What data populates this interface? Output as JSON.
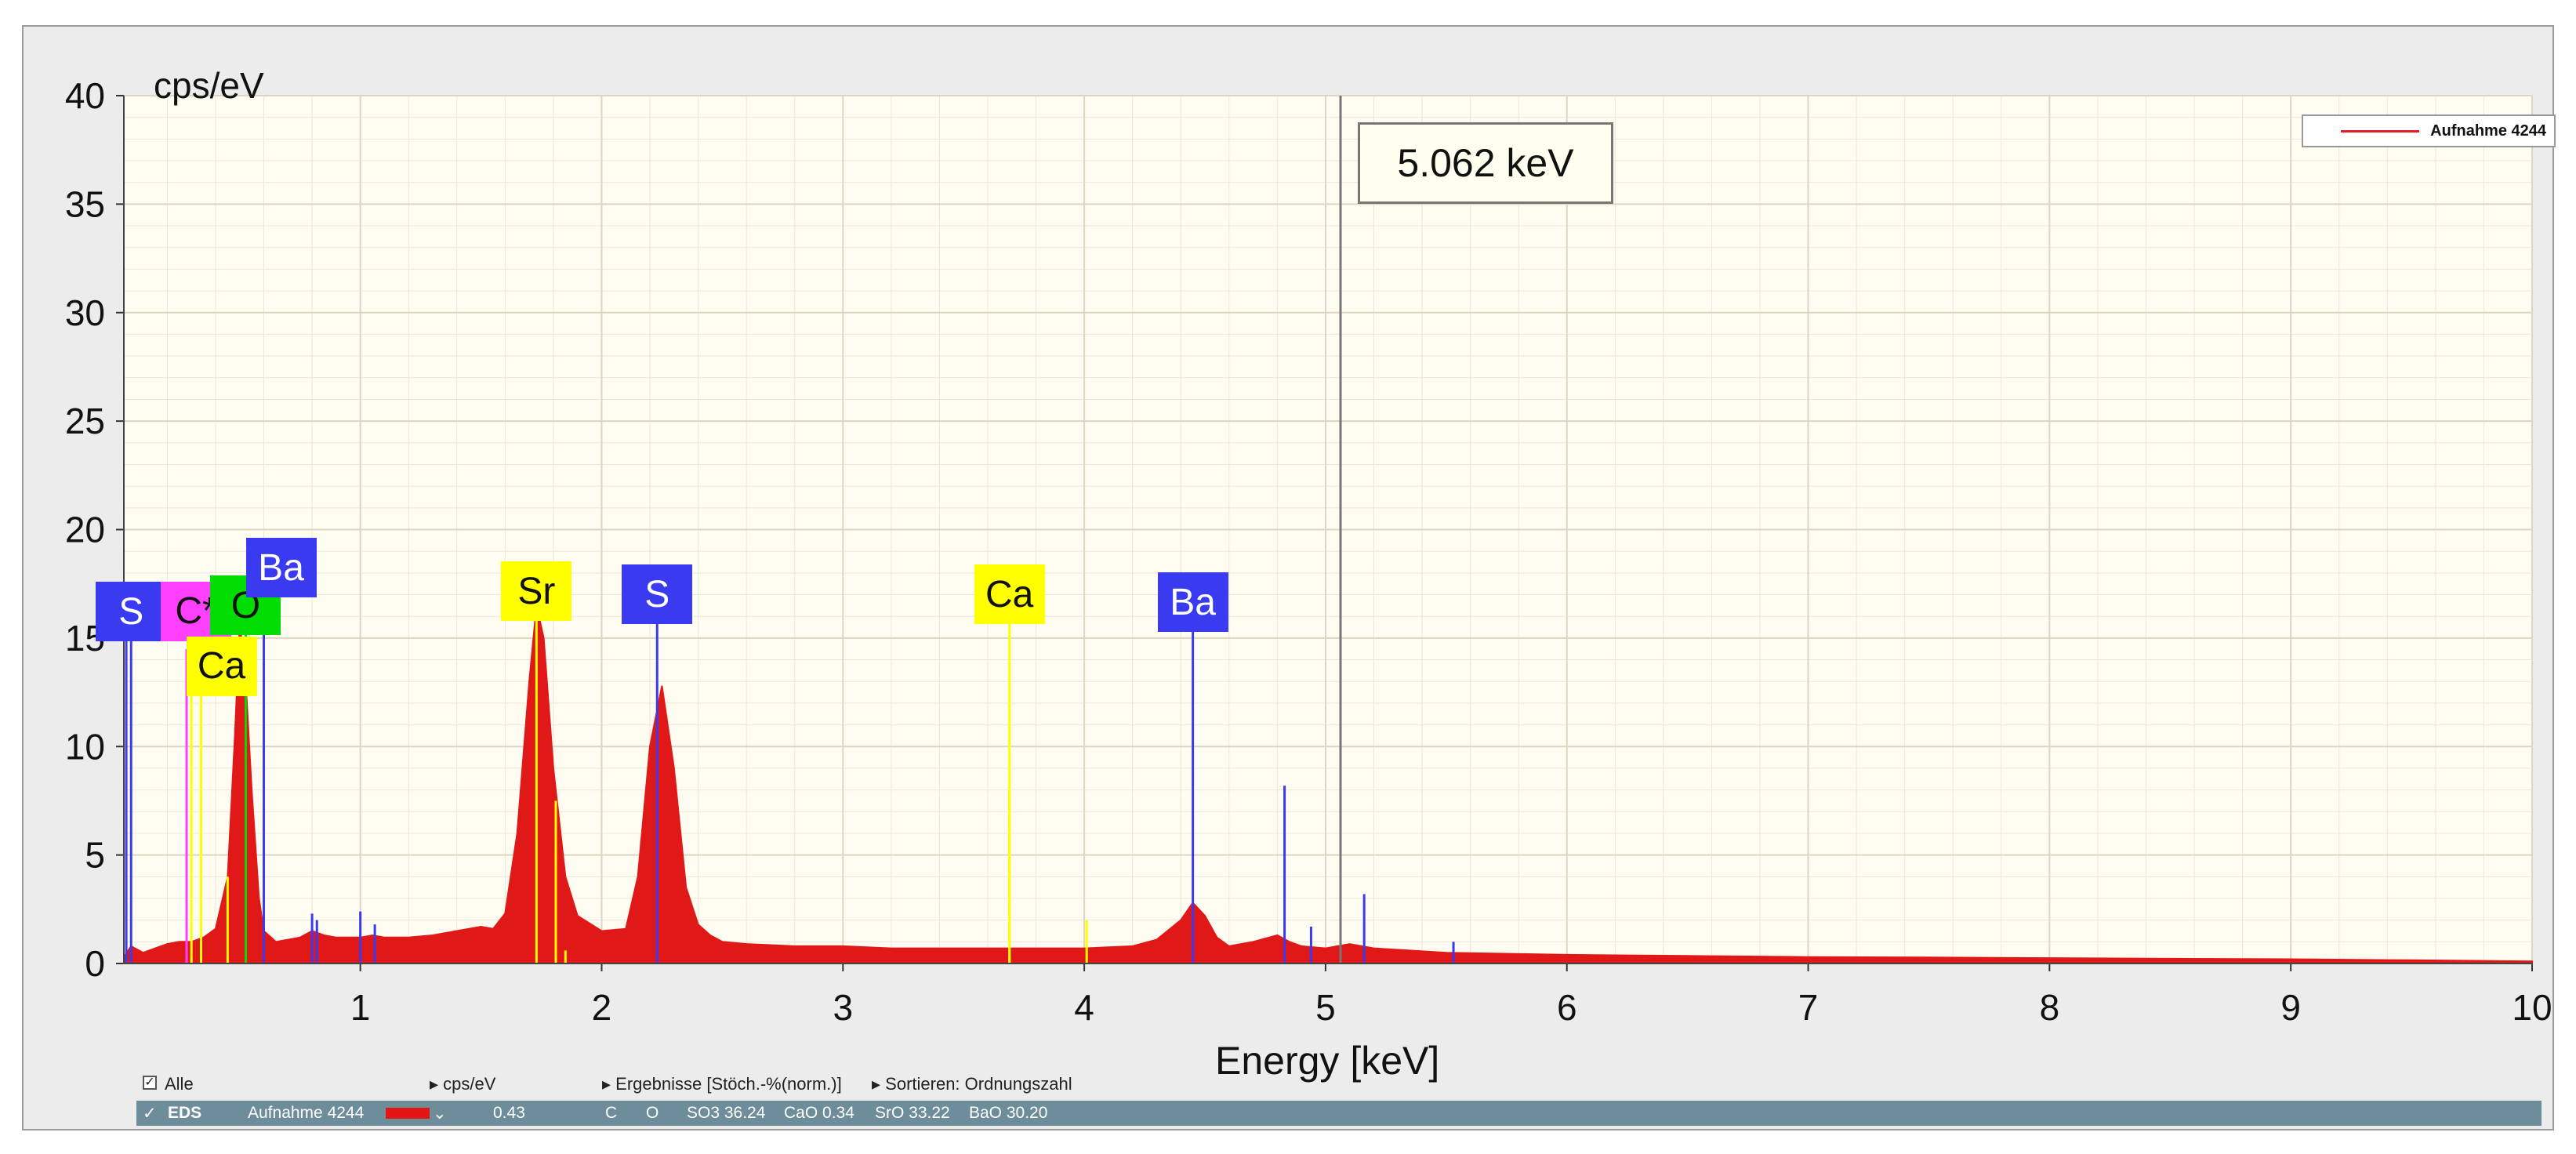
{
  "chart_data": {
    "type": "area",
    "ylabel": "cps/eV",
    "xlabel": "Energy [keV]",
    "xlim": [
      0.02,
      10
    ],
    "ylim": [
      0,
      40
    ],
    "x_ticks": [
      1,
      2,
      3,
      4,
      5,
      6,
      7,
      8,
      9,
      10
    ],
    "y_ticks": [
      0,
      5,
      10,
      15,
      20,
      25,
      30,
      35,
      40
    ],
    "grid": true,
    "legend": {
      "position": "top-right",
      "entries": [
        "Aufnahme 4244"
      ]
    },
    "cursor": {
      "x": 5.062,
      "label": "5.062 keV"
    },
    "series": [
      {
        "name": "Aufnahme 4244",
        "color": "#e01818",
        "x": [
          0.02,
          0.05,
          0.1,
          0.15,
          0.2,
          0.25,
          0.3,
          0.35,
          0.4,
          0.45,
          0.48,
          0.5,
          0.52,
          0.55,
          0.58,
          0.6,
          0.65,
          0.7,
          0.75,
          0.8,
          0.85,
          0.9,
          0.95,
          1.0,
          1.05,
          1.1,
          1.2,
          1.3,
          1.4,
          1.5,
          1.55,
          1.6,
          1.65,
          1.7,
          1.73,
          1.76,
          1.8,
          1.85,
          1.9,
          2.0,
          2.1,
          2.15,
          2.2,
          2.25,
          2.3,
          2.35,
          2.4,
          2.45,
          2.5,
          2.6,
          2.8,
          3.0,
          3.2,
          3.5,
          3.8,
          4.0,
          4.2,
          4.3,
          4.4,
          4.45,
          4.5,
          4.55,
          4.6,
          4.7,
          4.8,
          4.85,
          4.9,
          5.0,
          5.1,
          5.2,
          5.5,
          6.0,
          6.5,
          7.0,
          7.5,
          8.0,
          8.5,
          9.0,
          9.5,
          10.0
        ],
        "y": [
          0.3,
          0.8,
          0.5,
          0.7,
          0.9,
          1.0,
          1.0,
          1.2,
          1.6,
          4.0,
          10.5,
          15.6,
          14.0,
          8.0,
          3.0,
          1.5,
          1.0,
          1.1,
          1.2,
          1.5,
          1.3,
          1.2,
          1.2,
          1.2,
          1.3,
          1.2,
          1.2,
          1.3,
          1.5,
          1.7,
          1.6,
          2.3,
          6.0,
          13.0,
          16.5,
          15.0,
          9.0,
          4.0,
          2.2,
          1.5,
          1.6,
          4.0,
          10.0,
          12.8,
          9.0,
          3.5,
          1.8,
          1.3,
          1.0,
          0.9,
          0.8,
          0.8,
          0.7,
          0.7,
          0.7,
          0.7,
          0.8,
          1.1,
          2.0,
          2.8,
          2.2,
          1.2,
          0.8,
          1.0,
          1.3,
          1.0,
          0.8,
          0.7,
          0.9,
          0.7,
          0.5,
          0.4,
          0.35,
          0.3,
          0.28,
          0.25,
          0.22,
          0.2,
          0.15,
          0.1
        ]
      }
    ],
    "element_lines": [
      {
        "element": "S",
        "x": 0.05,
        "y": 16.0,
        "color": "#3a3af0"
      },
      {
        "element": "C*",
        "x": 0.28,
        "y": 14.5,
        "color": "#ff40ff"
      },
      {
        "element": "Ca",
        "x": 0.34,
        "y": 14.0,
        "color": "#ffff00"
      },
      {
        "element": "O",
        "x": 0.525,
        "y": 15.5,
        "color": "#00dd00"
      },
      {
        "element": "Ba",
        "x": 0.6,
        "y": 16.5,
        "color": "#3a3af0"
      },
      {
        "element": "Sr",
        "x": 1.73,
        "y": 16.5,
        "color": "#ffff00"
      },
      {
        "element": "S",
        "x": 2.23,
        "y": 16.0,
        "color": "#3a3af0"
      },
      {
        "element": "Ca",
        "x": 3.69,
        "y": 16.0,
        "color": "#ffff00"
      },
      {
        "element": "Ba",
        "x": 4.45,
        "y": 16.0,
        "color": "#3a3af0"
      }
    ],
    "minor_lines": [
      {
        "x": 0.03,
        "y": 15.0,
        "color": "#3a3af0"
      },
      {
        "x": 0.3,
        "y": 14.0,
        "color": "#ffff00"
      },
      {
        "x": 0.45,
        "y": 4.0,
        "color": "#ffff00"
      },
      {
        "x": 0.8,
        "y": 2.3,
        "color": "#3a3af0"
      },
      {
        "x": 0.82,
        "y": 2.0,
        "color": "#3a3af0"
      },
      {
        "x": 1.0,
        "y": 2.4,
        "color": "#3a3af0"
      },
      {
        "x": 1.06,
        "y": 1.8,
        "color": "#3a3af0"
      },
      {
        "x": 1.81,
        "y": 7.5,
        "color": "#ffff00"
      },
      {
        "x": 1.85,
        "y": 0.6,
        "color": "#ffff00"
      },
      {
        "x": 3.69,
        "y": 8.0,
        "color": "#ffff00"
      },
      {
        "x": 4.01,
        "y": 2.0,
        "color": "#ffff00"
      },
      {
        "x": 4.83,
        "y": 8.2,
        "color": "#3a3af0"
      },
      {
        "x": 4.94,
        "y": 1.7,
        "color": "#3a3af0"
      },
      {
        "x": 5.16,
        "y": 3.2,
        "color": "#3a3af0"
      },
      {
        "x": 5.53,
        "y": 1.0,
        "color": "#3a3af0"
      }
    ]
  },
  "legend_label": "Aufnahme 4244",
  "cursor_label": "5.062 keV",
  "controls": {
    "all_label": "Alle",
    "unit_label": "cps/eV",
    "results_label": "Ergebnisse [Stöch.-%(norm.)]",
    "sort_label": "Sortieren: Ordnungszahl"
  },
  "status": {
    "type": "EDS",
    "name": "Aufnahme 4244",
    "value": "0.43",
    "c": "C",
    "o": "O",
    "so3": "SO3 36.24",
    "cao": "CaO 0.34",
    "sro": "SrO 33.22",
    "bao": "BaO 30.20"
  },
  "colors": {
    "spectrum": "#e01818",
    "sulfur_barium": "#3a3af0",
    "carbon": "#ff40ff",
    "calcium_strontium": "#ffff00",
    "oxygen": "#00dd00",
    "status_bar": "#6e8d9a"
  }
}
